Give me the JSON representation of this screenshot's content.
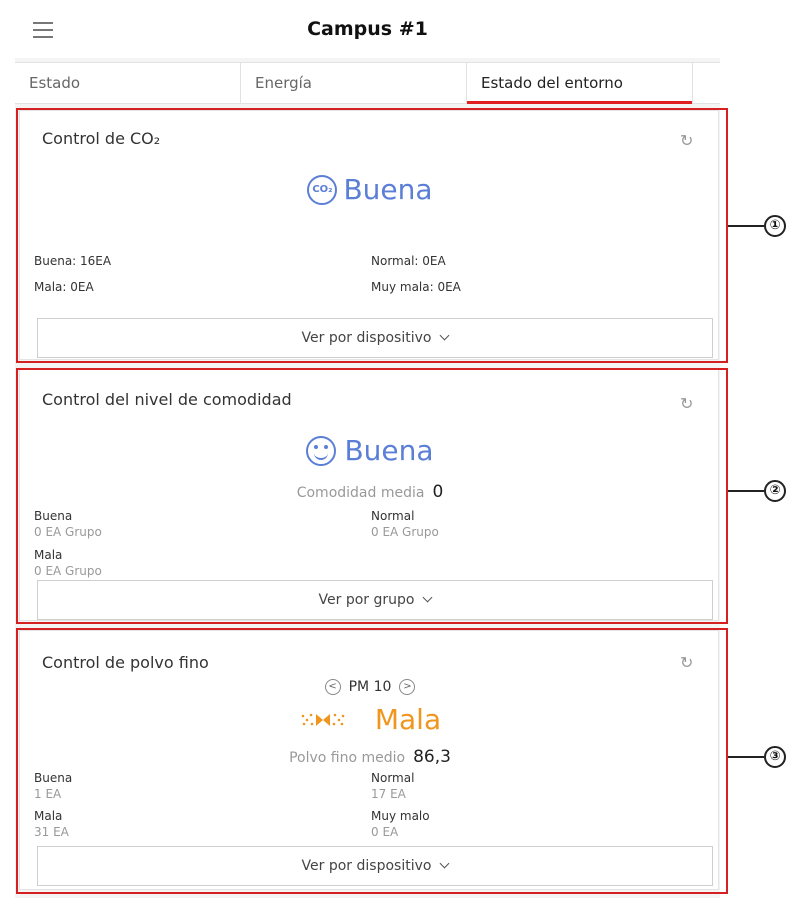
{
  "header": {
    "title": "Campus #1"
  },
  "tabs": [
    {
      "label": "Estado"
    },
    {
      "label": "Energía"
    },
    {
      "label": "Estado del entorno",
      "active": true
    }
  ],
  "co2": {
    "title": "Control de CO₂",
    "icon_text": "CO₂",
    "status": "Buena",
    "stats": [
      "Buena: 16EA",
      "Normal: 0EA",
      "Mala: 0EA",
      "Muy mala: 0EA"
    ],
    "button": "Ver por dispositivo"
  },
  "comfort": {
    "title": "Control del nivel de comodidad",
    "status": "Buena",
    "avg_label": "Comodidad media",
    "avg_value": "0",
    "stats": [
      {
        "label": "Buena",
        "value": "0 EA Grupo"
      },
      {
        "label": "Normal",
        "value": "0 EA Grupo"
      },
      {
        "label": "Mala",
        "value": "0 EA Grupo"
      }
    ],
    "button": "Ver por grupo"
  },
  "dust": {
    "title": "Control de polvo fino",
    "selector": "PM 10",
    "status": "Mala",
    "avg_label": "Polvo fino medio",
    "avg_value": "86,3",
    "stats": [
      {
        "label": "Buena",
        "value": "1 EA"
      },
      {
        "label": "Normal",
        "value": "17 EA"
      },
      {
        "label": "Mala",
        "value": "31 EA"
      },
      {
        "label": "Muy malo",
        "value": "0 EA"
      }
    ],
    "button": "Ver por dispositivo"
  },
  "callouts": [
    "①",
    "②",
    "③"
  ],
  "colors": {
    "accent_red": "#e02020",
    "good_blue": "#5b7fd6",
    "bad_orange": "#f0961e",
    "callout_red": "#d42020"
  },
  "icons": [
    "hamburger-icon",
    "refresh-icon",
    "co2-icon",
    "smile-icon",
    "dust-icon",
    "chevron-down-icon",
    "chevron-left-icon",
    "chevron-right-icon"
  ]
}
